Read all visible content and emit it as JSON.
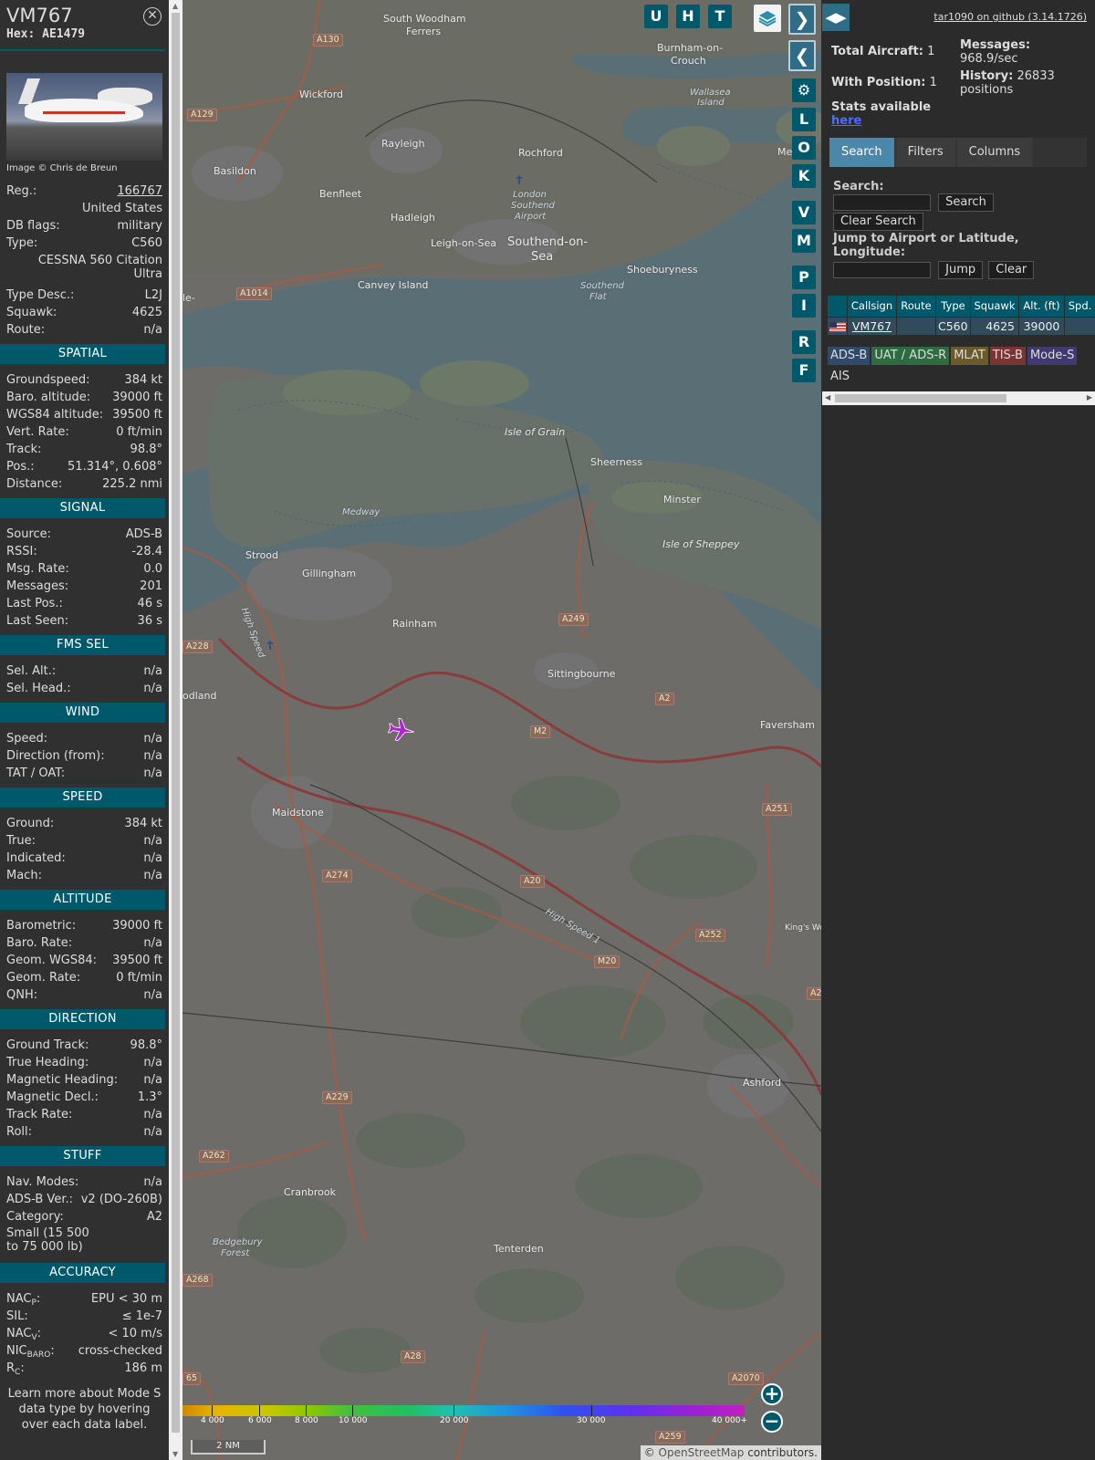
{
  "info": {
    "callsign": "VM767",
    "hex": "Hex: AE1479",
    "photo_credit": "Image © Chris de Breun",
    "reg_label": "Reg.:",
    "reg": "166767",
    "country": "United States",
    "dbflags_label": "DB flags:",
    "dbflags": "military",
    "type_label": "Type:",
    "type": "C560",
    "type_full": "CESSNA 560 Citation Ultra",
    "typedesc_label": "Type Desc.:",
    "typedesc": "L2J",
    "squawk_label": "Squawk:",
    "squawk": "4625",
    "route_label": "Route:",
    "route": "n/a",
    "sections": {
      "spatial": "SPATIAL",
      "signal": "SIGNAL",
      "fms": "FMS SEL",
      "wind": "WIND",
      "speed": "SPEED",
      "altitude": "ALTITUDE",
      "direction": "DIRECTION",
      "stuff": "STUFF",
      "accuracy": "ACCURACY"
    },
    "spatial": {
      "gs_label": "Groundspeed:",
      "gs": "384 kt",
      "baro_label": "Baro. altitude:",
      "baro": "39000 ft",
      "wgs_label": "WGS84 altitude:",
      "wgs": "39500 ft",
      "vrate_label": "Vert. Rate:",
      "vrate": "0 ft/min",
      "track_label": "Track:",
      "track": "98.8°",
      "pos_label": "Pos.:",
      "pos": "51.314°, 0.608°",
      "dist_label": "Distance:",
      "dist": "225.2 nmi"
    },
    "signal": {
      "src_label": "Source:",
      "src": "ADS-B",
      "rssi_label": "RSSI:",
      "rssi": "-28.4",
      "msgrate_label": "Msg. Rate:",
      "msgrate": "0.0",
      "msgs_label": "Messages:",
      "msgs": "201",
      "lastpos_label": "Last Pos.:",
      "lastpos": "46 s",
      "lastseen_label": "Last Seen:",
      "lastseen": "36 s"
    },
    "fms": {
      "selalt_label": "Sel. Alt.:",
      "selalt": "n/a",
      "selhead_label": "Sel. Head.:",
      "selhead": "n/a"
    },
    "wind": {
      "speed_label": "Speed:",
      "speed": "n/a",
      "dir_label": "Direction (from):",
      "dir": "n/a",
      "tat_label": "TAT / OAT:",
      "tat": "n/a"
    },
    "speed": {
      "ground_label": "Ground:",
      "ground": "384 kt",
      "true_label": "True:",
      "true": "n/a",
      "ind_label": "Indicated:",
      "ind": "n/a",
      "mach_label": "Mach:",
      "mach": "n/a"
    },
    "altitude": {
      "baro_label": "Barometric:",
      "baro": "39000 ft",
      "barorate_label": "Baro. Rate:",
      "barorate": "n/a",
      "geom_label": "Geom. WGS84:",
      "geom": "39500 ft",
      "geomrate_label": "Geom. Rate:",
      "geomrate": "0 ft/min",
      "qnh_label": "QNH:",
      "qnh": "n/a"
    },
    "direction": {
      "gtrack_label": "Ground Track:",
      "gtrack": "98.8°",
      "thead_label": "True Heading:",
      "thead": "n/a",
      "mhead_label": "Magnetic Heading:",
      "mhead": "n/a",
      "mdecl_label": "Magnetic Decl.:",
      "mdecl": "1.3°",
      "trate_label": "Track Rate:",
      "trate": "n/a",
      "roll_label": "Roll:",
      "roll": "n/a"
    },
    "stuff": {
      "nav_label": "Nav. Modes:",
      "nav": "n/a",
      "adsbver_label": "ADS-B Ver.:",
      "adsbver": "v2 (DO-260B)",
      "cat_label": "Category:",
      "cat": "A2",
      "cat_desc": "Small (15 500 to 75 000 lb)"
    },
    "accuracy": {
      "nacp_label": "NAC",
      "nacp_sub": "P",
      "nacp": "EPU < 30 m",
      "sil_label": "SIL:",
      "sil": "≤ 1e-7",
      "nacv_label": "NAC",
      "nacv_sub": "V",
      "nacv": "< 10 m/s",
      "nic_label": "NIC",
      "nic_sub": "BARO",
      "nic": "cross-checked",
      "rc_label": "R",
      "rc_sub": "C",
      "rc": "186 m"
    },
    "footer": "Learn more about Mode S data type by hovering over each data label."
  },
  "map": {
    "buttons": {
      "u": "U",
      "h": "H",
      "t": "T",
      "l": "L",
      "o": "O",
      "k": "K",
      "v": "V",
      "m": "M",
      "p": "P",
      "i": "I",
      "r": "R",
      "f": "F",
      "next": "❯",
      "prev": "❮",
      "settings": "⚙",
      "plus": "+",
      "minus": "−"
    },
    "places": {
      "south_woodham": "South Woodham",
      "ferrers": "Ferrers",
      "burnham": "Burnham-on-",
      "crouch": "Crouch",
      "wickford": "Wickford",
      "rayleigh": "Rayleigh",
      "rochford": "Rochford",
      "wallasea": "Wallasea",
      "island": "Island",
      "basildon": "Basildon",
      "benfleet": "Benfleet",
      "hadleigh": "Hadleigh",
      "london": "London",
      "southend": "Southend",
      "airport": "Airport",
      "leigh": "Leigh-on-Sea",
      "southend_on": "Southend-on-",
      "sea": "Sea",
      "shoebury": "Shoeburyness",
      "canvey": "Canvey Island",
      "southend_flat": "Southend",
      "flat": "Flat",
      "isle_grain": "Isle of Grain",
      "sheerness": "Sheerness",
      "minster": "Minster",
      "medway": "Medway",
      "sheppey": "Isle of Sheppey",
      "strood": "Strood",
      "gillingham": "Gillingham",
      "rainham": "Rainham",
      "sittingbourne": "Sittingbourne",
      "faversham": "Faversham",
      "maidstone": "Maidstone",
      "ashford": "Ashford",
      "cranbrook": "Cranbrook",
      "tenterden": "Tenterden",
      "bedgebury": "Bedgebury",
      "forest": "Forest",
      "kings_wood": "King's Wo",
      "high_speed": "High Speed",
      "high_speed2": "High Speed 1",
      "me": "Me",
      "le": "le-",
      "odland": "odland"
    },
    "roads": {
      "a130": "A130",
      "a129": "A129",
      "a1014": "A1014",
      "a228": "A228",
      "a249": "A249",
      "a2": "A2",
      "m2": "M2",
      "a251": "A251",
      "a274": "A274",
      "a20": "A20",
      "a252": "A252",
      "m20": "M20",
      "a229": "A229",
      "a262": "A262",
      "a268": "A268",
      "a28": "A28",
      "a2070": "A2070",
      "a259": "A259",
      "a2_edge": "A2",
      "a65": "65"
    },
    "alt_ticks": [
      "4 000",
      "6 000",
      "8 000",
      "10 000",
      "20 000",
      "30 000",
      "40 000+"
    ],
    "scale": "2 NM",
    "attribution_prefix": "© ",
    "attribution_link": "OpenStreetMap",
    "attribution_suffix": " contributors."
  },
  "sidebar": {
    "toggle": "◀▶",
    "version": "tar1090 on github (3.14.1726)",
    "total_label": "Total Aircraft:",
    "total": "1",
    "withpos_label": "With Position:",
    "withpos": "1",
    "stats_label": "Stats available",
    "stats_link": "here",
    "messages_label": "Messages:",
    "messages": "968.9/sec",
    "history_label": "History:",
    "history": "26833 positions",
    "tabs": [
      "Search",
      "Filters",
      "Columns"
    ],
    "search_label": "Search:",
    "search_btn": "Search",
    "clear_search": "Clear Search",
    "jump_label": "Jump to Airport or Latitude, Longitude:",
    "jump_btn": "Jump",
    "clear_btn": "Clear",
    "columns": [
      "Callsign",
      "Route",
      "Type",
      "Squawk",
      "Alt. (ft)",
      "Spd."
    ],
    "rows": [
      {
        "callsign": "VM767",
        "route": "",
        "type": "C560",
        "squawk": "4625",
        "alt": "39000",
        "spd": ""
      }
    ],
    "legend": [
      "ADS-B",
      "UAT / ADS-R",
      "MLAT",
      "TIS-B",
      "Mode-S",
      "AIS"
    ]
  }
}
